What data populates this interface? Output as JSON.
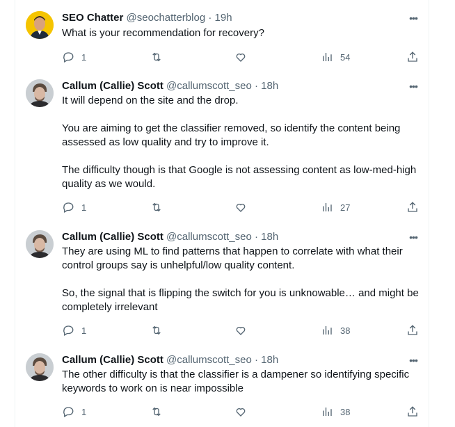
{
  "tweets": [
    {
      "name": "SEO Chatter",
      "handle": "@seochatterblog",
      "time": "19h",
      "more_label": "•••",
      "paragraphs": [
        "What is your recommendation for recovery?"
      ],
      "replies": "1",
      "views": "54",
      "avatar": "seo-chatter-avatar"
    },
    {
      "name": "Callum (Callie) Scott",
      "handle": "@callumscott_seo",
      "time": "18h",
      "more_label": "•••",
      "paragraphs": [
        "It will depend on the site and the drop.",
        "You are aiming to get the classifier removed, so identify the content being assessed as low quality and try to improve it.",
        "The difficulty though is that Google is not assessing content as low-med-high quality as we would."
      ],
      "replies": "1",
      "views": "27",
      "avatar": "callum-avatar"
    },
    {
      "name": "Callum (Callie) Scott",
      "handle": "@callumscott_seo",
      "time": "18h",
      "more_label": "•••",
      "paragraphs": [
        "They are using ML to find patterns that happen to correlate with what their control groups say is unhelpful/low quality content.",
        "So, the signal that is flipping the switch for you is unknowable… and might be completely irrelevant"
      ],
      "replies": "1",
      "views": "38",
      "avatar": "callum-avatar"
    },
    {
      "name": "Callum (Callie) Scott",
      "handle": "@callumscott_seo",
      "time": "18h",
      "more_label": "•••",
      "paragraphs": [
        "The other difficulty is that the classifier is a dampener so identifying specific keywords to work on is near impossible"
      ],
      "replies": "1",
      "views": "38",
      "avatar": "callum-avatar"
    }
  ],
  "separator": "·",
  "colors": {
    "text": "#0f1419",
    "secondary": "#536471",
    "border": "#eff3f4",
    "seo_avatar_bg": "#f5c400"
  }
}
